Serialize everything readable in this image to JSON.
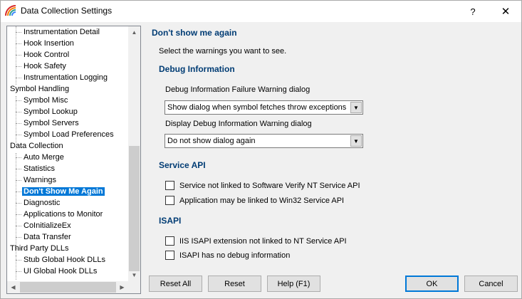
{
  "window": {
    "title": "Data Collection Settings",
    "help_label": "?",
    "close_label": "✕"
  },
  "tree": {
    "items": [
      {
        "label": "Instrumentation Detail",
        "level": 1
      },
      {
        "label": "Hook Insertion",
        "level": 1
      },
      {
        "label": "Hook Control",
        "level": 1
      },
      {
        "label": "Hook Safety",
        "level": 1
      },
      {
        "label": "Instrumentation Logging",
        "level": 1
      },
      {
        "label": "Symbol Handling",
        "level": 0
      },
      {
        "label": "Symbol Misc",
        "level": 1
      },
      {
        "label": "Symbol Lookup",
        "level": 1
      },
      {
        "label": "Symbol Servers",
        "level": 1
      },
      {
        "label": "Symbol Load Preferences",
        "level": 1
      },
      {
        "label": "Data Collection",
        "level": 0
      },
      {
        "label": "Auto Merge",
        "level": 1
      },
      {
        "label": "Statistics",
        "level": 1
      },
      {
        "label": "Warnings",
        "level": 1
      },
      {
        "label": "Don't Show Me Again",
        "level": 1,
        "selected": true
      },
      {
        "label": "Diagnostic",
        "level": 1
      },
      {
        "label": "Applications to Monitor",
        "level": 1
      },
      {
        "label": "CoInitializeEx",
        "level": 1
      },
      {
        "label": "Data Transfer",
        "level": 1
      },
      {
        "label": "Third Party DLLs",
        "level": 0
      },
      {
        "label": "Stub Global Hook DLLs",
        "level": 1
      },
      {
        "label": "UI Global Hook DLLs",
        "level": 1
      }
    ]
  },
  "panel": {
    "title": "Don't show me again",
    "intro": "Select the warnings you want to see.",
    "debug": {
      "heading": "Debug Information",
      "failure_label": "Debug Information Failure Warning dialog",
      "failure_value": "Show dialog when symbol fetches throw exceptions",
      "display_label": "Display Debug Information Warning dialog",
      "display_value": "Do not show dialog again"
    },
    "service": {
      "heading": "Service API",
      "option1": "Service not linked to Software Verify NT Service API",
      "option2": "Application may be linked to Win32 Service API"
    },
    "isapi": {
      "heading": "ISAPI",
      "option1": "IIS ISAPI extension not linked to NT Service API",
      "option2": "ISAPI has no debug information"
    }
  },
  "buttons": {
    "reset_all": "Reset All",
    "reset": "Reset",
    "help": "Help (F1)",
    "ok": "OK",
    "cancel": "Cancel"
  }
}
